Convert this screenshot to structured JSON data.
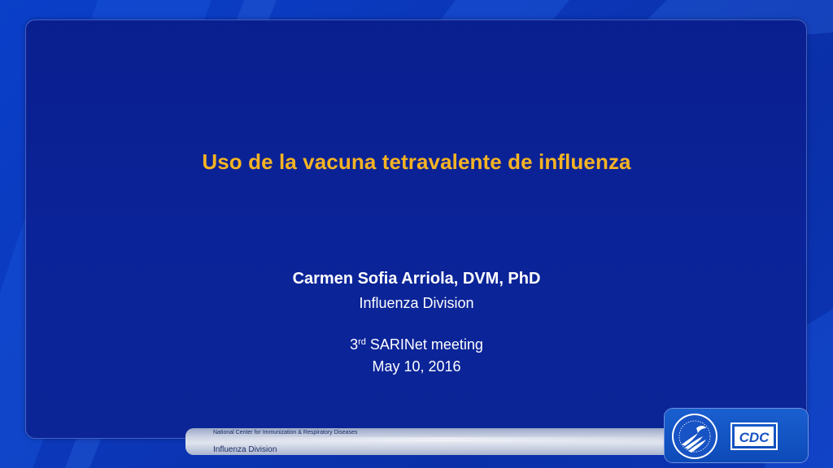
{
  "slide": {
    "title": "Uso de la vacuna tetravalente de influenza",
    "author": "Carmen Sofia Arriola, DVM, PhD",
    "division": "Influenza Division",
    "meeting_ordinal_number": "3",
    "meeting_ordinal_suffix": "rd",
    "meeting_name": " SARINet meeting",
    "date": "May 10, 2016"
  },
  "footer": {
    "center_name": "National Center for Immunization & Respiratory Diseases",
    "division_name": "Influenza Division"
  },
  "logos": {
    "hhs_seal_icon": "hhs-seal-icon",
    "cdc_logo_text": "CDC"
  },
  "colors": {
    "title": "#f5b323",
    "background": "#0b2597",
    "text": "#ffffff"
  }
}
